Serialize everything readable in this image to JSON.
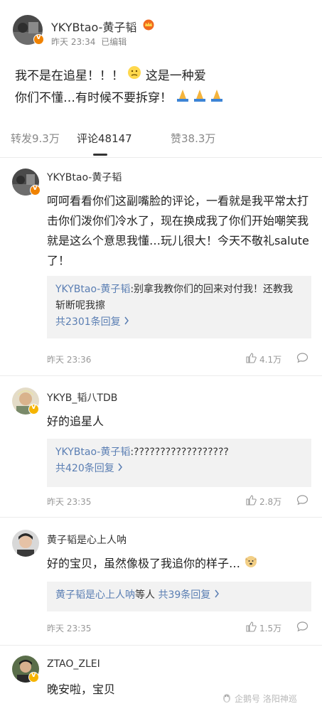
{
  "post": {
    "username": "YKYBtao-黄子韬",
    "time": "昨天 23:34",
    "edited": "已编辑",
    "line1a": "我不是在追星！！！",
    "line1b": "这是一种爱",
    "line2": "你们不懂…有时候不要拆穿！"
  },
  "tabs": {
    "repost": "转发9.3万",
    "comments": "评论48147",
    "likes": "赞38.3万"
  },
  "comments": [
    {
      "username": "YKYBtao-黄子韬",
      "text": "呵呵看看你们这副嘴脸的评论，一看就是我平常太打击你们泼你们冷水了，现在换成我了你们开始嘲笑我就是这么个意思我懂…玩儿很大！今天不敬礼salute了！",
      "reply_author": "YKYBtao-黄子韬",
      "reply_text": ":别拿我教你们的回来对付我！还教我斩断呢我擦",
      "reply_count": "共2301条回复",
      "time": "昨天 23:36",
      "likes": "4.1万"
    },
    {
      "username": "YKYB_韬八TDB",
      "text": "好的追星人",
      "reply_author": "YKYBtao-黄子韬",
      "reply_text": ":??????????????????",
      "reply_count": "共420条回复",
      "time": "昨天 23:35",
      "likes": "2.8万"
    },
    {
      "username": "黄子韬是心上人呐",
      "text": "好的宝贝，虽然像极了我追你的样子…",
      "reply_author": "黄子韬是心上人呐",
      "reply_mid": "等人",
      "reply_count": "共39条回复",
      "time": "昨天 23:35",
      "likes": "1.5万"
    },
    {
      "username": "ZTAO_ZLEI",
      "text": "晚安啦，宝贝"
    }
  ],
  "watermark": "企鹅号 洛阳神巡",
  "colors": {
    "link": "#5a7eb3",
    "badge_orange": "#f08200",
    "badge_yellow": "#f5b400"
  }
}
